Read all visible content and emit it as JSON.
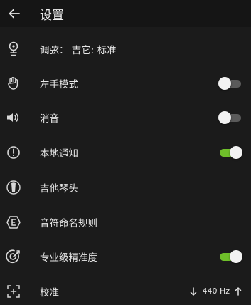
{
  "appbar": {
    "title": "设置",
    "back_icon": "arrow-left-icon"
  },
  "settings": [
    {
      "label": "调弦： 吉它: 标准",
      "icon": "tuning-peg-icon"
    },
    {
      "label": "左手模式",
      "icon": "hand-icon",
      "toggle": "off"
    },
    {
      "label": "消音",
      "icon": "speaker-icon",
      "toggle": "off"
    },
    {
      "label": "本地通知",
      "icon": "alert-circle-icon",
      "toggle": "on"
    },
    {
      "label": "吉他琴头",
      "icon": "headstock-icon"
    },
    {
      "label": "音符命名规则",
      "icon": "note-e-icon"
    },
    {
      "label": "专业级精准度",
      "icon": "target-icon",
      "toggle": "on"
    },
    {
      "label": "校准",
      "icon": "crosshair-icon",
      "value": "440 Hz"
    }
  ],
  "colors": {
    "background": "#1b1b1b",
    "appbar": "#151515",
    "toggle_on": "#6fbf2a",
    "toggle_off": "#5a5a5a"
  }
}
